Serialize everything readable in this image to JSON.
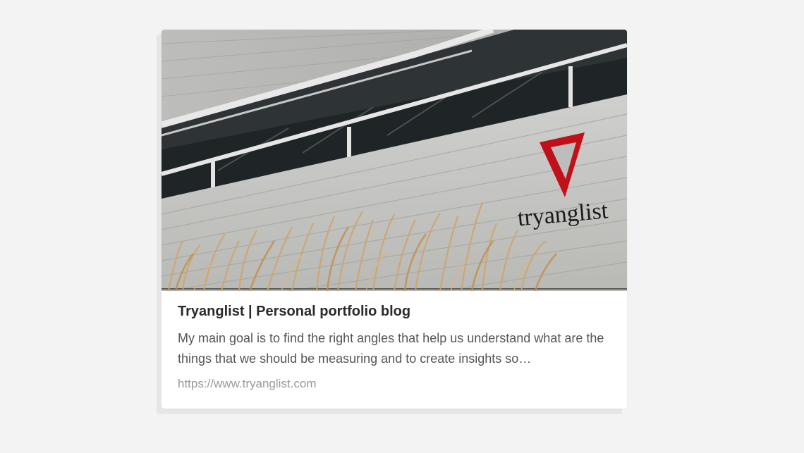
{
  "link_card": {
    "title": "Tryanglist | Personal portfolio blog",
    "description": "My main goal is to find the right angles that help us understand what are the things that we should be measuring and to create insights so…",
    "url": "https://www.tryanglist.com",
    "image_logo_text": "tryanglist",
    "accent_color": "#c0111a"
  }
}
